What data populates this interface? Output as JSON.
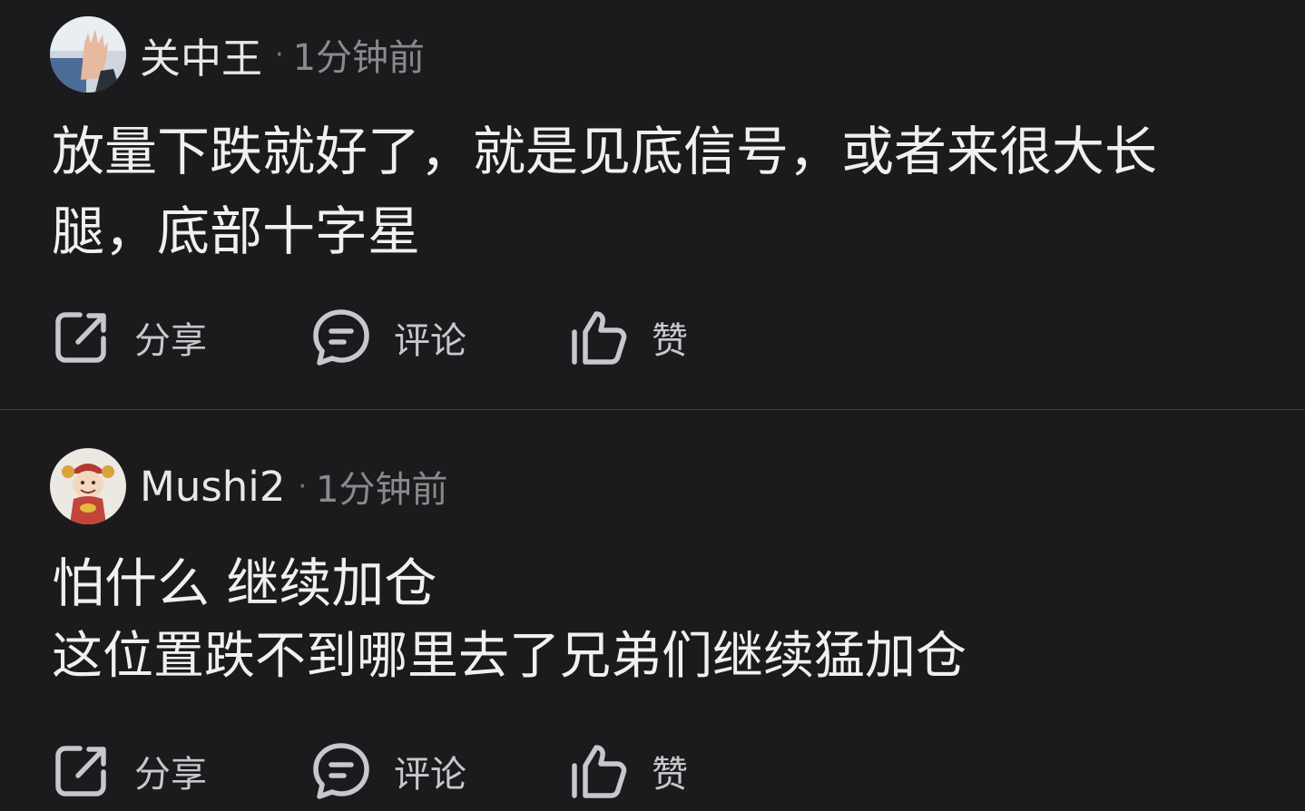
{
  "posts": [
    {
      "username": "关中王",
      "separator": "·",
      "time": "1分钟前",
      "content_lines": [
        "放量下跌就好了，就是见底信号，或者来很大长",
        "腿，底部十字星"
      ],
      "actions": {
        "share": "分享",
        "comment": "评论",
        "like": "赞"
      }
    },
    {
      "username": "Mushi2",
      "separator": "·",
      "time": "1分钟前",
      "content_lines": [
        "怕什么 继续加仓",
        "这位置跌不到哪里去了兄弟们继续猛加仓"
      ],
      "actions": {
        "share": "分享",
        "comment": "评论",
        "like": "赞"
      }
    }
  ],
  "icons": {
    "share": "share-icon",
    "comment": "comment-icon",
    "like": "thumbs-up-icon"
  },
  "colors": {
    "background": "#1b1b1d",
    "text": "#f0f0f0",
    "muted": "#8a8a8e",
    "icon": "#c8c8cc",
    "divider": "#3a3a3c"
  }
}
